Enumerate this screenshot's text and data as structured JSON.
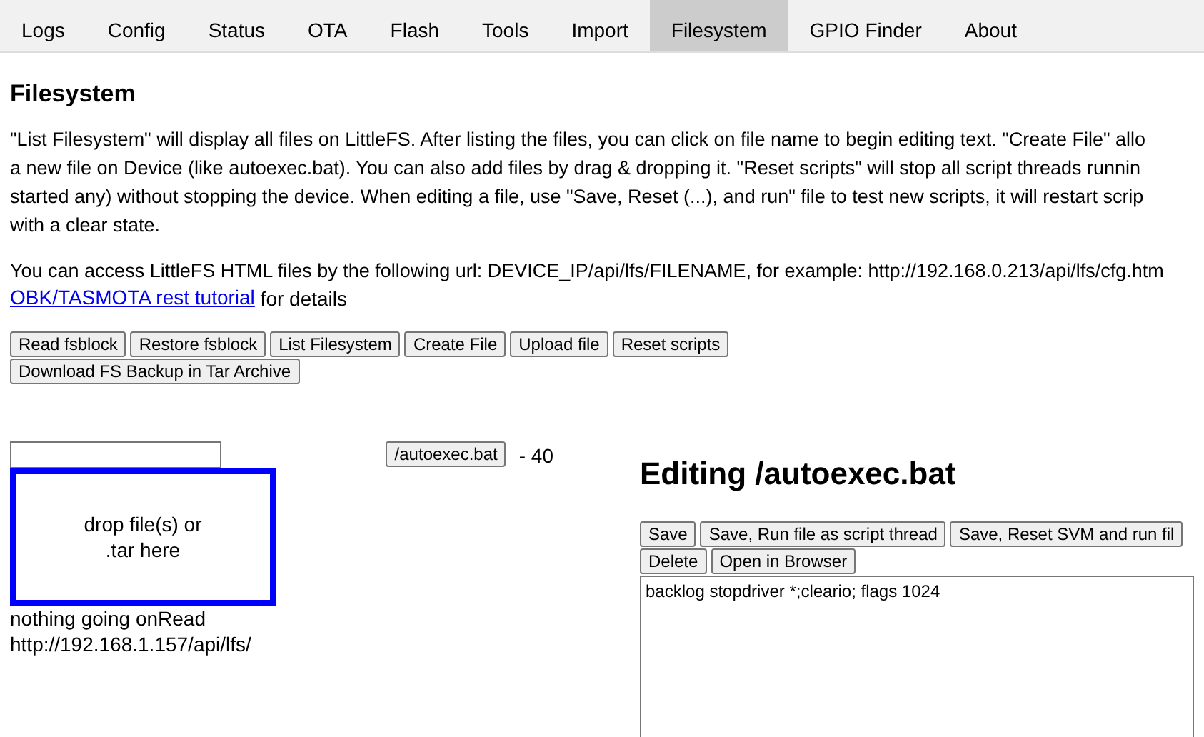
{
  "tabs": [
    {
      "label": "Logs",
      "selected": false
    },
    {
      "label": "Config",
      "selected": false
    },
    {
      "label": "Status",
      "selected": false
    },
    {
      "label": "OTA",
      "selected": false
    },
    {
      "label": "Flash",
      "selected": false
    },
    {
      "label": "Tools",
      "selected": false
    },
    {
      "label": "Import",
      "selected": false
    },
    {
      "label": "Filesystem",
      "selected": true
    },
    {
      "label": "GPIO Finder",
      "selected": false
    },
    {
      "label": "About",
      "selected": false
    }
  ],
  "title": "Filesystem",
  "description_lines": [
    "\"List Filesystem\" will display all files on LittleFS. After listing the files, you can click on file name to begin editing text. \"Create File\" allo",
    "a new file on Device (like autoexec.bat). You can also add files by drag & dropping it. \"Reset scripts\" will stop all script threads runnin",
    "started any) without stopping the device. When editing a file, use \"Save, Reset (...), and run\" file to test new scripts, it will restart scrip",
    "with a clear state."
  ],
  "access_line": "You can access LittleFS HTML files by the following url: DEVICE_IP/api/lfs/FILENAME, for example: http://192.168.0.213/api/lfs/cfg.htm",
  "tutorial_link": "OBK/TASMOTA rest tutorial",
  "tutorial_suffix": " for details",
  "buttons": [
    "Read fsblock",
    "Restore fsblock",
    "List Filesystem",
    "Create File",
    "Upload file",
    "Reset scripts",
    "Download FS Backup in Tar Archive"
  ],
  "drop_zone": {
    "line_1": "drop file(s) or",
    "line_2": ".tar here"
  },
  "status_text": "nothing going onRead",
  "url_text": "http://192.168.1.157/api/lfs/",
  "files": [
    {
      "name": "/autoexec.bat",
      "size": "- 40"
    }
  ],
  "editor": {
    "heading": "Editing /autoexec.bat",
    "buttons": [
      "Save",
      "Save, Run file as script thread",
      "Save, Reset SVM and run fil",
      "Delete",
      "Open in Browser"
    ],
    "content": "backlog stopdriver *;cleario; flags 1024"
  }
}
